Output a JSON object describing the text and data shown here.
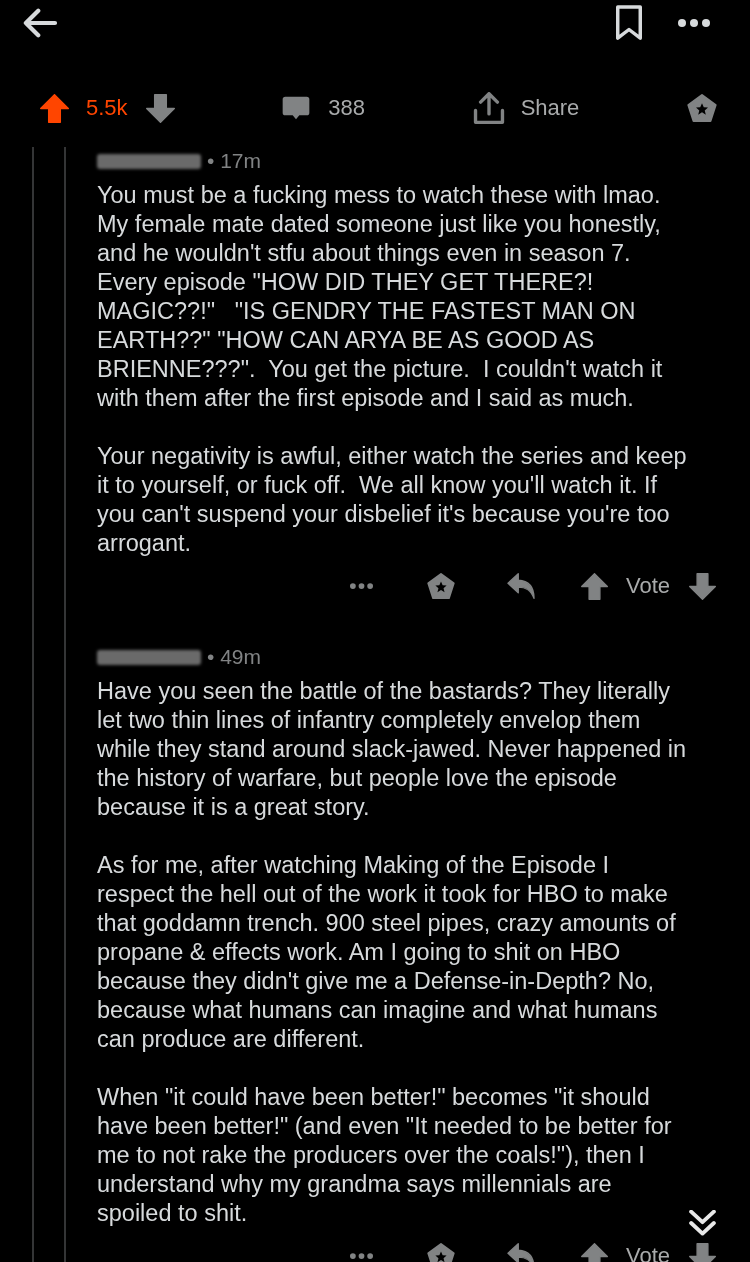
{
  "post_actions": {
    "upvoted": true,
    "downvoted": false,
    "score": "5.5k",
    "comments": "388",
    "share": "Share"
  },
  "comments": [
    {
      "author_hidden": true,
      "meta": "• 17m",
      "paragraphs": [
        "You must be a fucking mess to watch these with lmao.\nMy female mate dated someone just like you honestly,\nand he wouldn't stfu about things even in season 7.\nEvery episode \"HOW DID THEY GET THERE?!\nMAGIC??!\"   \"IS GENDRY THE FASTEST MAN ON\nEARTH??\" \"HOW CAN ARYA BE AS GOOD AS\nBRIENNE???\".  You get the picture.  I couldn't watch it\nwith them after the first episode and I said as much.",
        "Your negativity is awful, either watch the series and keep\nit to yourself, or fuck off.  We all know you'll watch it. If\nyou can't suspend your disbelief it's because you're too\narrogant."
      ],
      "upvoted": false,
      "downvoted": false,
      "vote_label": "Vote"
    },
    {
      "author_hidden": true,
      "meta": "• 49m",
      "paragraphs": [
        "Have you seen the battle of the bastards? They literally\nlet two thin lines of infantry completely envelop them\nwhile they stand around slack-jawed. Never happened in\nthe history of warfare, but people love the episode\nbecause it is a great story.",
        "As for me, after watching Making of the Episode I\nrespect the hell out of the work it took for HBO to make\nthat goddamn trench. 900 steel pipes, crazy amounts of\npropane & effects work. Am I going to shit on HBO\nbecause they didn't give me a Defense-in-Depth? No,\nbecause what humans can imagine and what humans\ncan produce are different.",
        "When \"it could have been better!\" becomes \"it should\nhave been better!\" (and even \"It needed to be better for\nme to not rake the producers over the coals!\"), then I\nunderstand why my grandma says millennials are\nspoiled to shit."
      ],
      "upvoted": false,
      "downvoted": false,
      "vote_label": "Vote"
    }
  ]
}
